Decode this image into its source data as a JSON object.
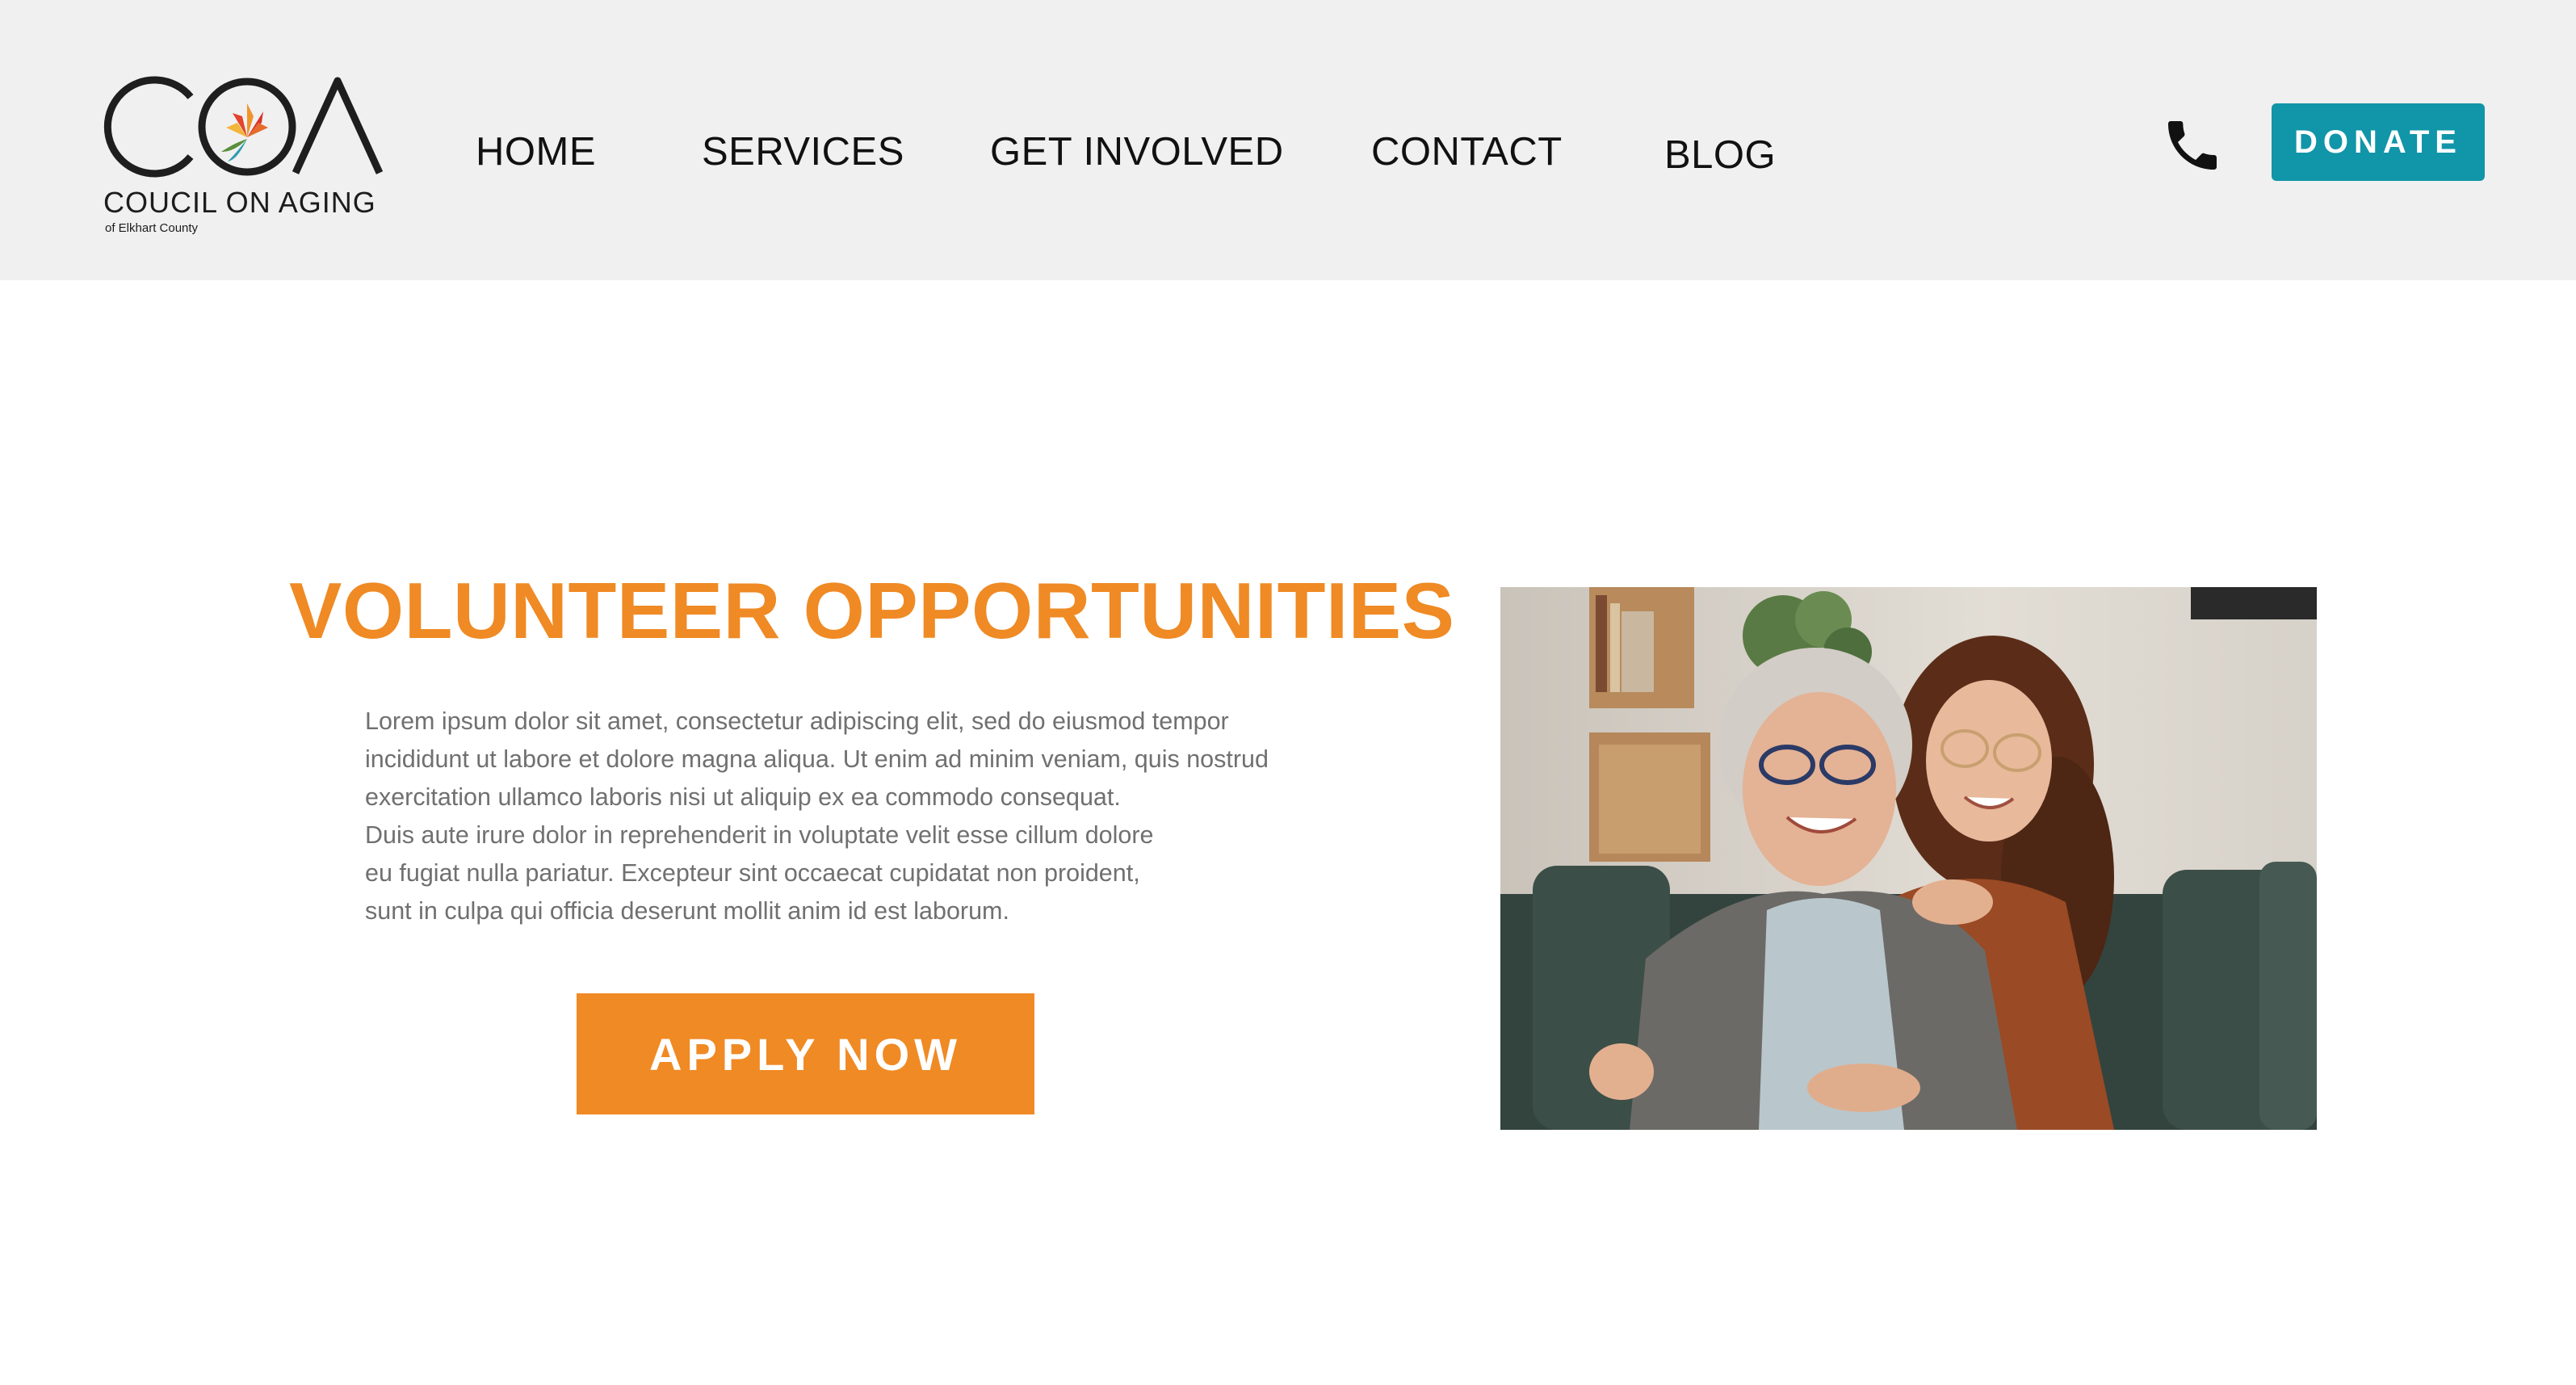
{
  "header": {
    "logo": {
      "letters": "COA",
      "name": "COUCIL ON AGING",
      "subtitle": "of Elkhart County"
    },
    "nav": [
      {
        "label": "HOME"
      },
      {
        "label": "SERVICES"
      },
      {
        "label": "GET INVOLVED"
      },
      {
        "label": "CONTACT"
      },
      {
        "label": "BLOG"
      }
    ],
    "phone_icon": "phone-icon",
    "donate_label": "DONATE"
  },
  "main": {
    "title": "VOLUNTEER OPPORTUNITIES",
    "body_lines": [
      "Lorem ipsum dolor sit amet, consectetur adipiscing elit, sed do eiusmod tempor",
      "incididunt ut labore et dolore magna aliqua. Ut enim ad minim veniam, quis nostrud",
      "exercitation ullamco laboris nisi ut aliquip ex ea commodo consequat.",
      "Duis aute irure dolor in reprehenderit in voluptate velit esse cillum dolore",
      "eu fugiat nulla pariatur. Excepteur sint occaecat cupidatat non proident,",
      "sunt in culpa qui officia deserunt mollit anim id est laborum."
    ],
    "apply_label": "APPLY NOW"
  },
  "colors": {
    "header_bg": "#f0f0f0",
    "accent_orange": "#ef8a24",
    "donate_teal": "#1195a8",
    "body_text": "#707070"
  }
}
